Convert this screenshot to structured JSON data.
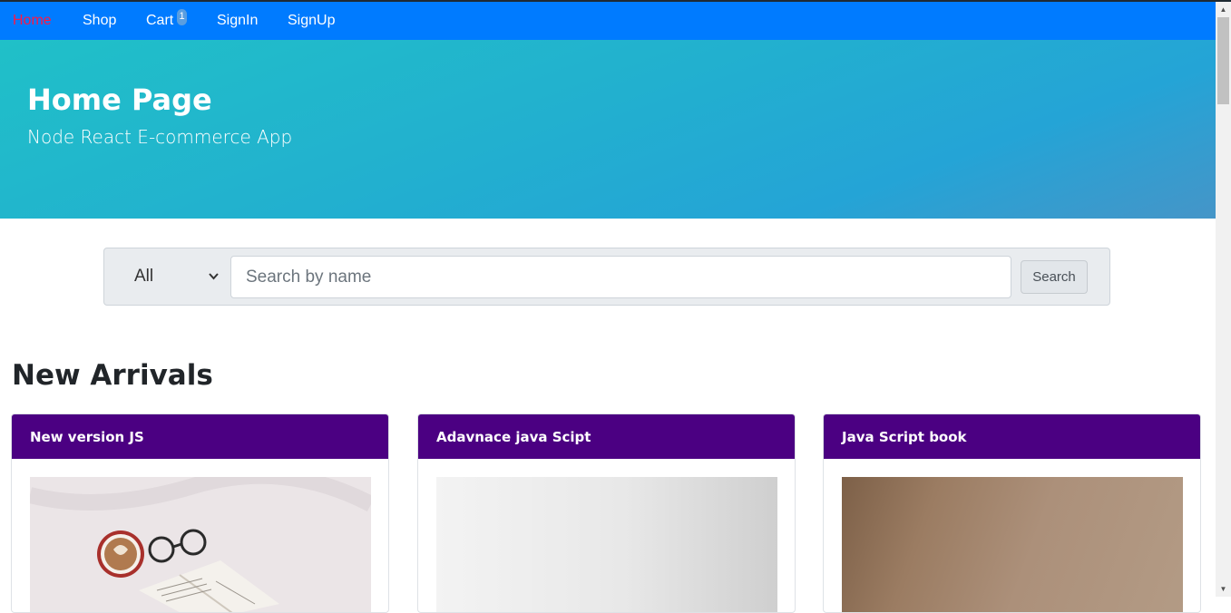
{
  "nav": {
    "items": [
      {
        "label": "Home",
        "active": true
      },
      {
        "label": "Shop"
      },
      {
        "label": "Cart"
      },
      {
        "label": "SignIn"
      },
      {
        "label": "SignUp"
      }
    ],
    "cart_count": "1"
  },
  "hero": {
    "title": "Home Page",
    "subtitle": "Node React E-commerce App"
  },
  "search": {
    "category": "All",
    "placeholder": "Search by name",
    "button_label": "Search"
  },
  "section": {
    "title": "New Arrivals"
  },
  "products": [
    {
      "name": "New version JS"
    },
    {
      "name": "Adavnace java Scipt"
    },
    {
      "name": "Java Script book"
    }
  ],
  "colors": {
    "navbar": "#007bff",
    "active_link": "#ff1744",
    "card_header": "#4b0082"
  }
}
